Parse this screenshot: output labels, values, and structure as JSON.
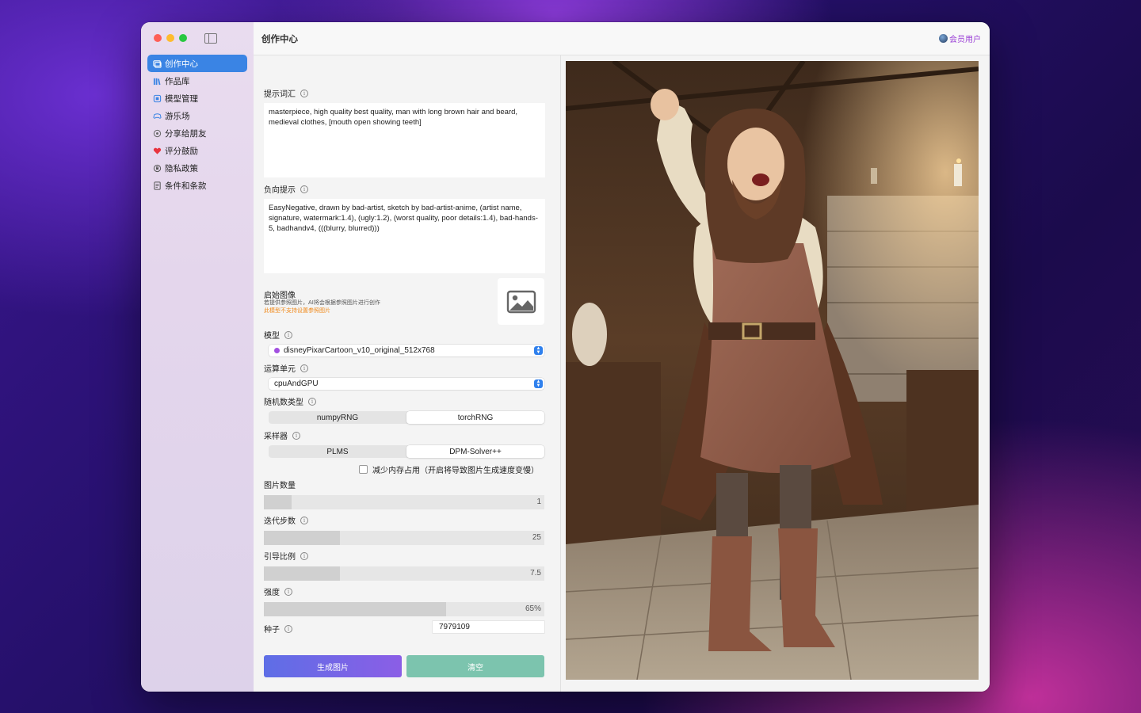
{
  "window": {
    "title": "创作中心"
  },
  "sidebar": {
    "items": [
      {
        "label": "创作中心",
        "icon": "gallery-icon"
      },
      {
        "label": "作品库",
        "icon": "library-icon"
      },
      {
        "label": "模型管理",
        "icon": "model-icon"
      },
      {
        "label": "游乐场",
        "icon": "gamepad-icon"
      },
      {
        "label": "分享给朋友",
        "icon": "share-icon"
      },
      {
        "label": "评分鼓励",
        "icon": "heart-icon"
      },
      {
        "label": "隐私政策",
        "icon": "shield-icon"
      },
      {
        "label": "条件和条款",
        "icon": "document-icon"
      }
    ]
  },
  "header": {
    "member_label": "会员用户"
  },
  "form": {
    "prompt_label": "提示词汇",
    "prompt_value": "masterpiece, high quality best quality, man with long brown hair and beard, medieval clothes, [mouth open showing teeth]",
    "negative_label": "负向提示",
    "negative_value": "EasyNegative, drawn by bad-artist, sketch by bad-artist-anime, (artist name, signature, watermark:1.4), (ugly:1.2), (worst quality, poor details:1.4), bad-hands-5, badhandv4, (((blurry, blurred)))",
    "start_image_label": "启始图像",
    "start_image_hint": "若提供参照图片，AI将会根据参照图片进行创作",
    "start_image_warning": "此模型不支持设置参照图片",
    "model_label": "模型",
    "model_value": "disneyPixarCartoon_v10_original_512x768",
    "compute_label": "运算单元",
    "compute_value": "cpuAndGPU",
    "rng_label": "随机数类型",
    "rng_options": [
      "numpyRNG",
      "torchRNG"
    ],
    "rng_selected": "torchRNG",
    "sampler_label": "采样器",
    "sampler_options": [
      "PLMS",
      "DPM-Solver++"
    ],
    "sampler_selected": "DPM-Solver++",
    "reduce_memory_label": "减少内存占用（开启将导致图片生成速度变慢）",
    "reduce_memory_checked": false,
    "count_label": "图片数量",
    "count_value": "1",
    "count_fraction": 0.1,
    "steps_label": "迭代步数",
    "steps_value": "25",
    "steps_fraction": 0.27,
    "guidance_label": "引导比例",
    "guidance_value": "7.5",
    "guidance_fraction": 0.27,
    "strength_label": "强度",
    "strength_value": "65%",
    "strength_fraction": 0.65,
    "seed_label": "种子",
    "seed_value": "7979109",
    "generate_label": "生成图片",
    "clear_label": "清空"
  },
  "colors": {
    "accent": "#3a84e4",
    "member": "#9a3fd6",
    "generate_start": "#5e6ee6",
    "generate_end": "#8b5ee6",
    "clear": "#7cc4ae",
    "warning": "#f08a1c"
  }
}
